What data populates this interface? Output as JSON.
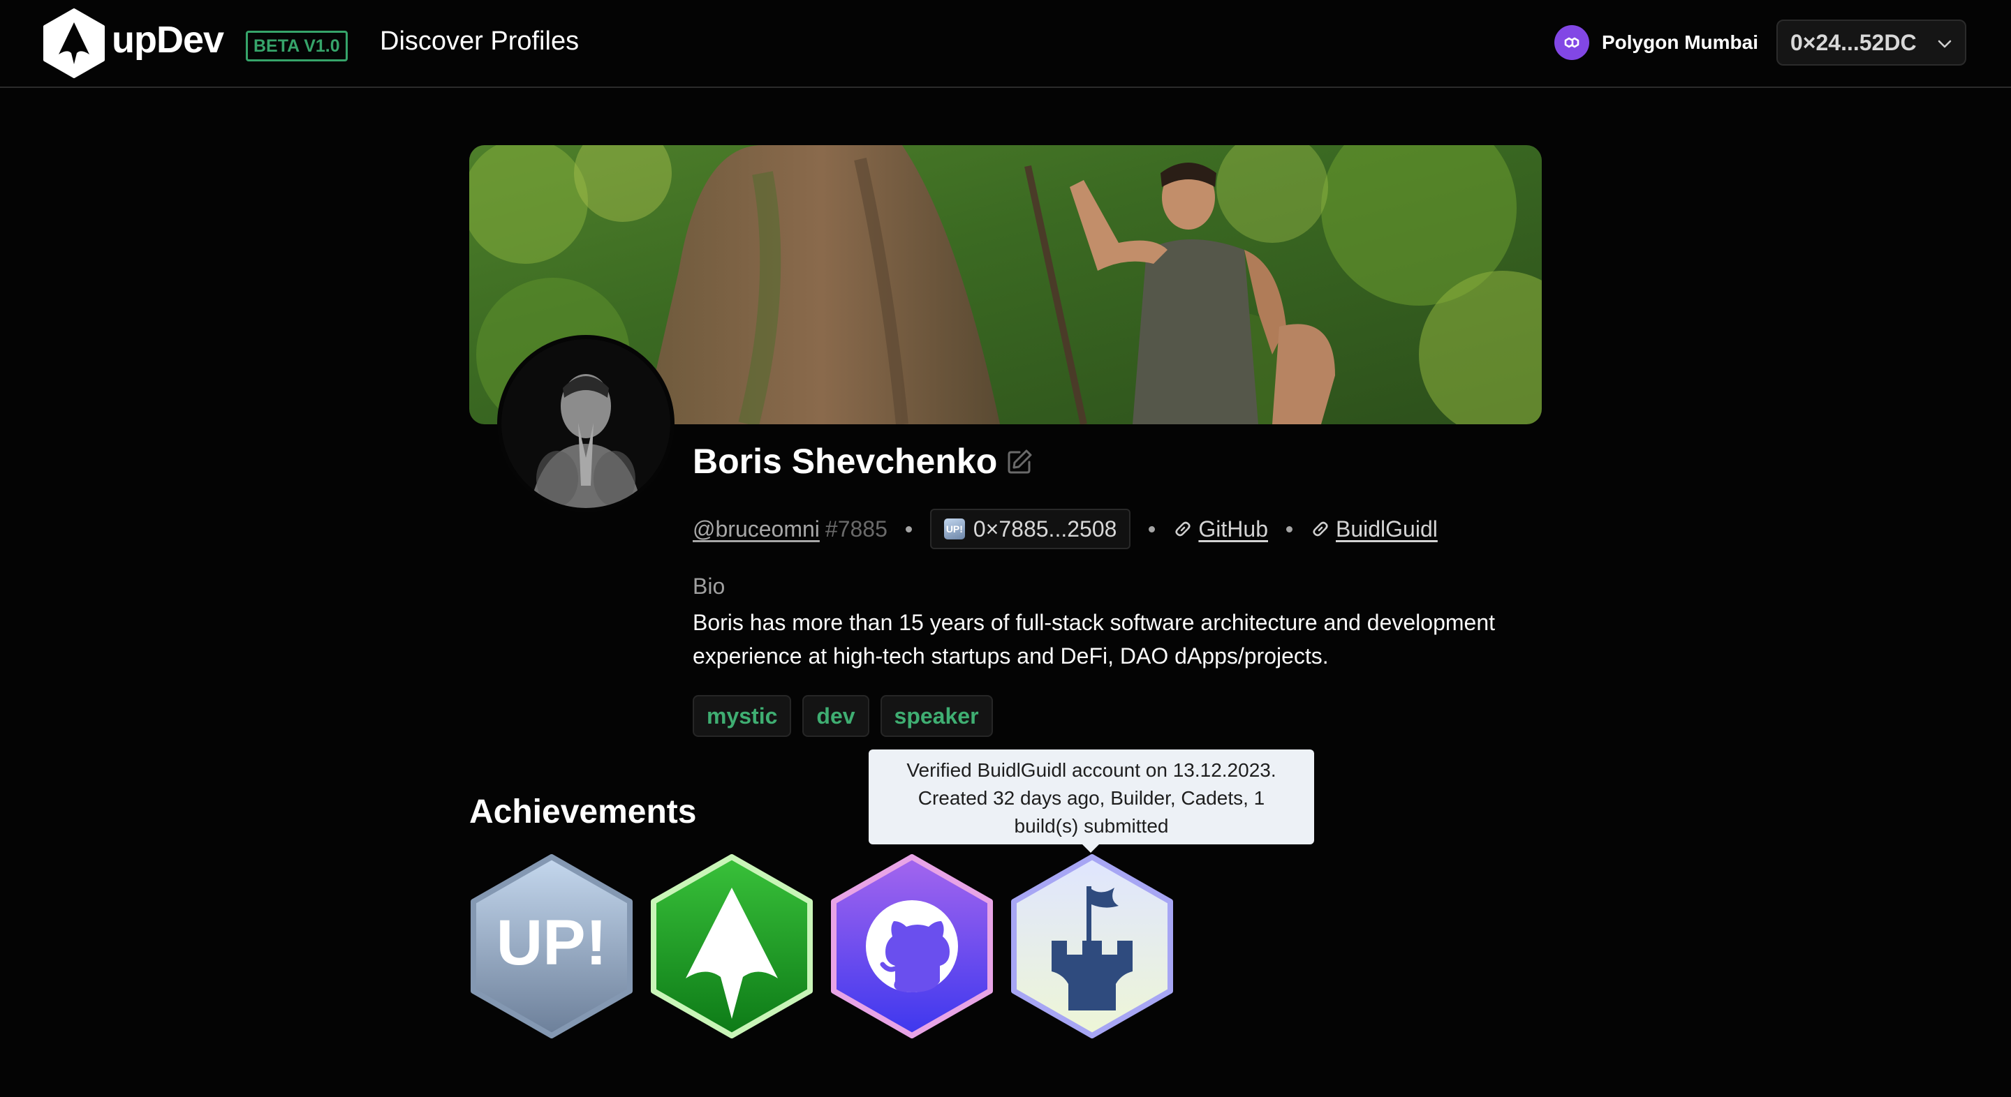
{
  "header": {
    "brand": "upDev",
    "beta_badge": "BETA V1.0",
    "nav_discover": "Discover Profiles",
    "network_label": "Polygon Mumbai",
    "wallet_label": "0×24...52DC",
    "logo_icon": "updev-logo-icon",
    "network_icon": "polygon-icon",
    "wallet_icon": "chevron-down-icon"
  },
  "profile": {
    "name": "Boris Shevchenko",
    "handle": "@bruceomni",
    "discriminator": "#7885",
    "address": "0×7885...2508",
    "address_icon_text": "UP!",
    "links": [
      {
        "label": "GitHub",
        "icon": "link-icon"
      },
      {
        "label": "BuidlGuidl",
        "icon": "link-icon"
      }
    ],
    "bio_label": "Bio",
    "bio": "Boris has more than 15 years of full-stack software architecture and development experience at high-tech startups and DeFi, DAO dApps/projects.",
    "tags": [
      "mystic",
      "dev",
      "speaker"
    ],
    "edit_icon": "edit-icon"
  },
  "achievements": {
    "title": "Achievements",
    "badges": [
      {
        "name": "up-badge",
        "text": "UP!"
      },
      {
        "name": "updev-badge",
        "icon": "updev-arrow-icon"
      },
      {
        "name": "github-badge",
        "icon": "github-icon"
      },
      {
        "name": "buidlguidl-badge",
        "icon": "castle-flag-icon"
      }
    ],
    "tooltip": "Verified BuidlGuidl account on 13.12.2023. Created 32 days ago, Builder, Cadets, 1 build(s) submitted"
  },
  "colors": {
    "background": "#040404",
    "accent_green": "#3fae72",
    "polygon_purple": "#8247e5",
    "tooltip_bg": "#edf1f6"
  }
}
